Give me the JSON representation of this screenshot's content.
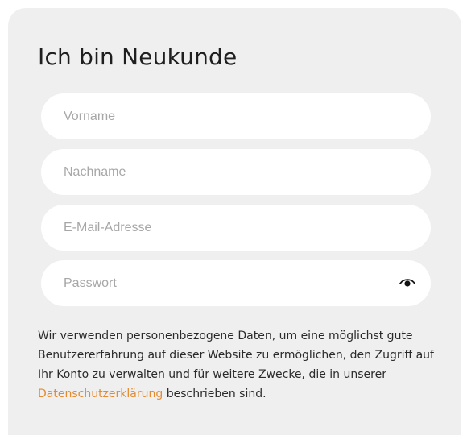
{
  "form": {
    "title": "Ich bin Neukunde",
    "fields": [
      {
        "name": "firstname",
        "placeholder": "Vorname",
        "value": ""
      },
      {
        "name": "lastname",
        "placeholder": "Nachname",
        "value": ""
      },
      {
        "name": "email",
        "placeholder": "E-Mail-Adresse",
        "value": ""
      },
      {
        "name": "password",
        "placeholder": "Passwort",
        "value": ""
      }
    ],
    "password_toggle_icon": "eye-icon",
    "privacy_text_before": "Wir verwenden personenbezogene Daten, um eine möglichst gute Benutzererfahrung auf dieser Website zu ermöglichen, den Zugriff auf Ihr Konto zu verwalten und für weitere Zwecke, die in unserer ",
    "privacy_link": "Datenschutzerklärung",
    "privacy_text_after": " beschrieben sind."
  },
  "colors": {
    "panel_bg": "#efefef",
    "field_bg": "#ffffff",
    "link": "#e58a2e",
    "placeholder": "#a7a7a7"
  }
}
